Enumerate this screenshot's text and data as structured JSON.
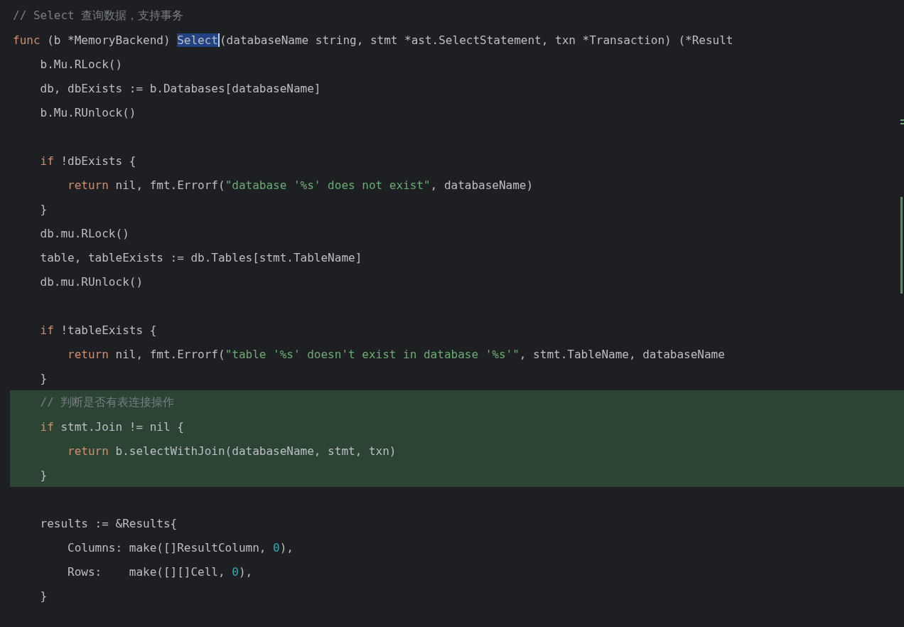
{
  "editor": {
    "lines": [
      {
        "highlighted": false,
        "changed": false,
        "tokens": [
          {
            "kind": "comment",
            "text": "// Select 查询数据，支持事务"
          }
        ]
      },
      {
        "highlighted": false,
        "changed": false,
        "tokens": [
          {
            "kind": "keyword",
            "text": "func"
          },
          {
            "kind": "plain",
            "text": " (b *MemoryBackend) "
          },
          {
            "kind": "plain",
            "text": "Select",
            "selected": true
          },
          {
            "kind": "plain",
            "text": "(databaseName string, stmt *ast.SelectStatement, txn *Transaction) (*Result"
          }
        ]
      },
      {
        "highlighted": false,
        "changed": false,
        "tokens": [
          {
            "kind": "plain",
            "text": "    b.Mu.RLock()"
          }
        ]
      },
      {
        "highlighted": false,
        "changed": false,
        "tokens": [
          {
            "kind": "plain",
            "text": "    db, dbExists := b.Databases[databaseName]"
          }
        ]
      },
      {
        "highlighted": false,
        "changed": false,
        "tokens": [
          {
            "kind": "plain",
            "text": "    b.Mu.RUnlock()"
          }
        ]
      },
      {
        "highlighted": false,
        "changed": false
      },
      {
        "highlighted": false,
        "changed": false,
        "tokens": [
          {
            "kind": "keyword",
            "text": "    if"
          },
          {
            "kind": "plain",
            "text": " !dbExists {"
          }
        ]
      },
      {
        "highlighted": false,
        "changed": false,
        "tokens": [
          {
            "kind": "keyword",
            "text": "        return"
          },
          {
            "kind": "plain",
            "text": " nil, fmt.Errorf("
          },
          {
            "kind": "string",
            "text": "\"database '%s' does not exist\""
          },
          {
            "kind": "plain",
            "text": ", databaseName)"
          }
        ]
      },
      {
        "highlighted": false,
        "changed": true,
        "tokens": [
          {
            "kind": "plain",
            "text": "    }"
          }
        ]
      },
      {
        "highlighted": false,
        "changed": true,
        "tokens": [
          {
            "kind": "plain",
            "text": "    db.mu.RLock()"
          }
        ]
      },
      {
        "highlighted": false,
        "changed": true,
        "tokens": [
          {
            "kind": "plain",
            "text": "    table, tableExists := db.Tables[stmt.TableName]"
          }
        ]
      },
      {
        "highlighted": false,
        "changed": true,
        "tokens": [
          {
            "kind": "plain",
            "text": "    db.mu.RUnlock()"
          }
        ]
      },
      {
        "highlighted": false,
        "changed": false
      },
      {
        "highlighted": false,
        "changed": false,
        "tokens": [
          {
            "kind": "keyword",
            "text": "    if"
          },
          {
            "kind": "plain",
            "text": " !tableExists {"
          }
        ]
      },
      {
        "highlighted": false,
        "changed": false,
        "tokens": [
          {
            "kind": "keyword",
            "text": "        return"
          },
          {
            "kind": "plain",
            "text": " nil, fmt.Errorf("
          },
          {
            "kind": "string",
            "text": "\"table '%s' doesn't exist in database '%s'\""
          },
          {
            "kind": "plain",
            "text": ", stmt.TableName, databaseName"
          }
        ]
      },
      {
        "highlighted": false,
        "changed": false,
        "tokens": [
          {
            "kind": "plain",
            "text": "    }"
          }
        ]
      },
      {
        "highlighted": true,
        "changed": false,
        "tokens": [
          {
            "kind": "comment",
            "text": "    // 判断是否有表连接操作"
          }
        ]
      },
      {
        "highlighted": true,
        "changed": false,
        "tokens": [
          {
            "kind": "keyword",
            "text": "    if"
          },
          {
            "kind": "plain",
            "text": " stmt.Join != nil {"
          }
        ]
      },
      {
        "highlighted": true,
        "changed": false,
        "tokens": [
          {
            "kind": "keyword",
            "text": "        return"
          },
          {
            "kind": "plain",
            "text": " b.selectWithJoin(databaseName, stmt, txn)"
          }
        ]
      },
      {
        "highlighted": true,
        "changed": false,
        "tokens": [
          {
            "kind": "plain",
            "text": "    }"
          }
        ]
      },
      {
        "highlighted": false,
        "changed": false
      },
      {
        "highlighted": false,
        "changed": false,
        "tokens": [
          {
            "kind": "plain",
            "text": "    results := &Results{"
          }
        ]
      },
      {
        "highlighted": false,
        "changed": false,
        "tokens": [
          {
            "kind": "plain",
            "text": "        Columns: make([]ResultColumn, "
          },
          {
            "kind": "number",
            "text": "0"
          },
          {
            "kind": "plain",
            "text": "),"
          }
        ]
      },
      {
        "highlighted": false,
        "changed": false,
        "tokens": [
          {
            "kind": "plain",
            "text": "        Rows:    make([][]Cell, "
          },
          {
            "kind": "number",
            "text": "0"
          },
          {
            "kind": "plain",
            "text": "),"
          }
        ]
      },
      {
        "highlighted": false,
        "changed": false,
        "tokens": [
          {
            "kind": "plain",
            "text": "    }"
          }
        ]
      }
    ]
  }
}
